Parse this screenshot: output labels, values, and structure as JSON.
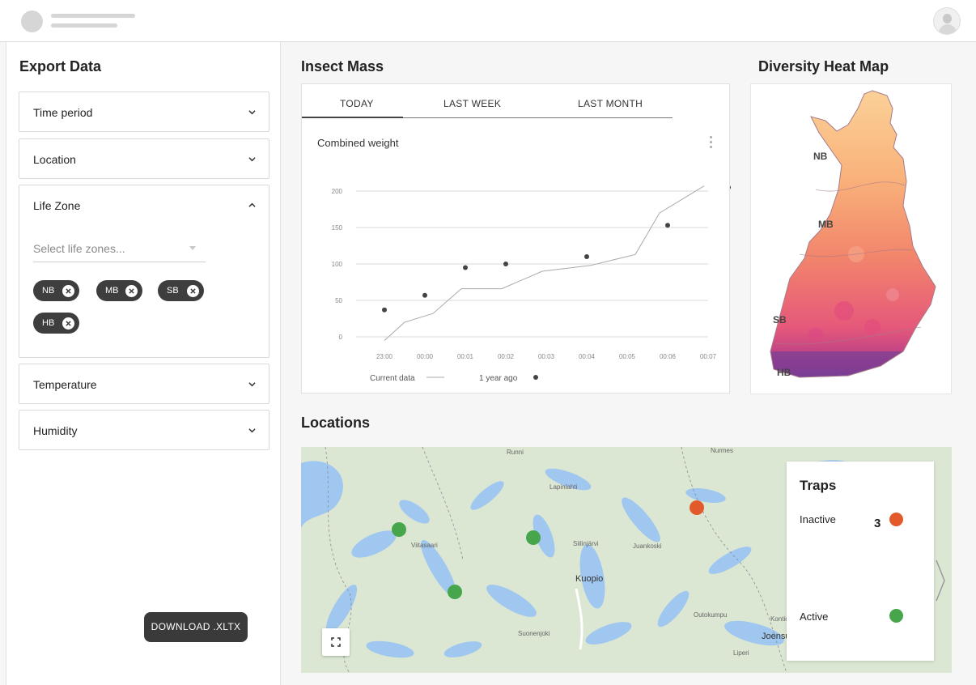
{
  "sidebar": {
    "title": "Export Data",
    "filters": [
      {
        "label": "Time period",
        "expanded": false
      },
      {
        "label": "Location",
        "expanded": false
      },
      {
        "label": "Life Zone",
        "expanded": true
      },
      {
        "label": "Temperature",
        "expanded": false
      },
      {
        "label": "Humidity",
        "expanded": false
      }
    ],
    "life_zone_placeholder": "Select life zones...",
    "life_zone_chips": [
      "NB",
      "MB",
      "SB",
      "HB"
    ],
    "download_label": "DOWNLOAD .XLTX"
  },
  "insect_mass": {
    "title": "Insect Mass",
    "tabs": [
      "TODAY",
      "LAST WEEK",
      "LAST MONTH"
    ],
    "active_tab": "TODAY",
    "subtitle": "Combined weight"
  },
  "chart_data": {
    "type": "line",
    "title": "Combined weight",
    "x": [
      "23:00",
      "00:00",
      "00:01",
      "00:02",
      "00:03",
      "00:04",
      "00:05",
      "00:06",
      "00:07"
    ],
    "ylim": [
      0,
      200
    ],
    "yticks": [
      0,
      50,
      100,
      150,
      200
    ],
    "grid": true,
    "legend_position": "bottom",
    "series": [
      {
        "name": "Current data",
        "style": "line",
        "color": "#aaaaaa",
        "points": [
          [
            0,
            -5
          ],
          [
            0.5,
            20
          ],
          [
            1.2,
            32
          ],
          [
            1.9,
            66
          ],
          [
            2.9,
            66
          ],
          [
            3.9,
            90
          ],
          [
            5.1,
            98
          ],
          [
            6.2,
            113
          ],
          [
            6.8,
            170
          ],
          [
            7.9,
            207
          ]
        ]
      },
      {
        "name": "1 year ago",
        "style": "dots",
        "color": "#444444",
        "points": [
          [
            0,
            37
          ],
          [
            1,
            57
          ],
          [
            2,
            95
          ],
          [
            3,
            100
          ],
          [
            5,
            110
          ],
          [
            7,
            153
          ],
          [
            8.6,
            205
          ]
        ]
      }
    ]
  },
  "heat_map": {
    "title": "Diversity Heat Map",
    "zone_labels": [
      "NB",
      "MB",
      "SB",
      "HB"
    ]
  },
  "locations": {
    "title": "Locations",
    "places": [
      "Runni",
      "Nurmes",
      "Lapinlahti",
      "Viitasaari",
      "Siilinjärvi",
      "Juankoski",
      "Kuopio",
      "Suonenjoki",
      "Outokumpu",
      "Kontiolahti",
      "Joensuu",
      "Liperi"
    ],
    "legend": {
      "title": "Traps",
      "inactive_label": "Inactive",
      "inactive_count": "3",
      "active_label": "Active",
      "inactive_color": "#e25a2c",
      "active_color": "#47a64b"
    }
  }
}
